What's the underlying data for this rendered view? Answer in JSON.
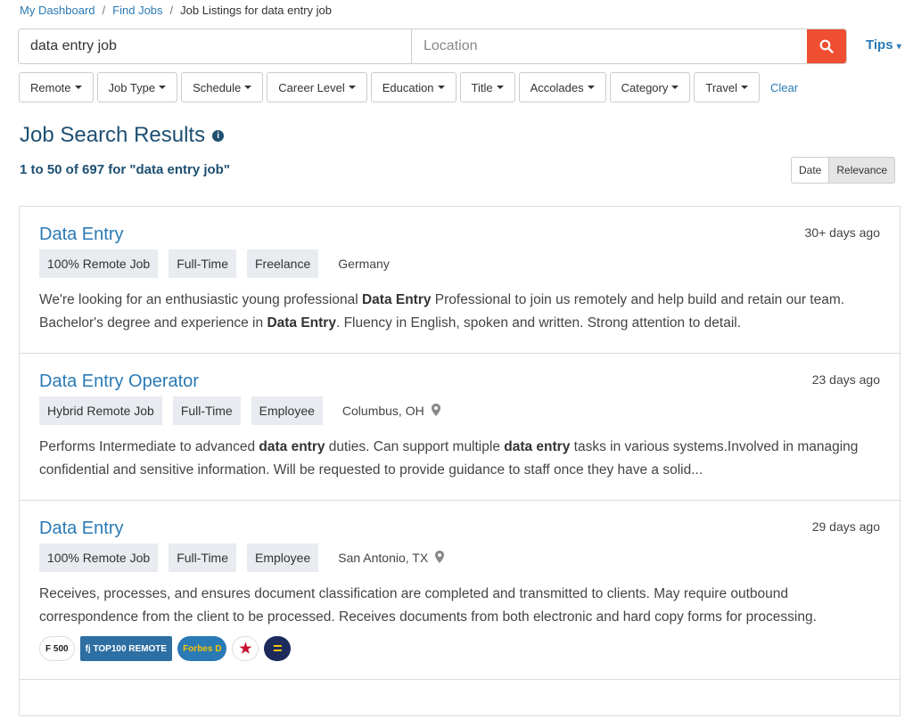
{
  "breadcrumb": {
    "items": [
      "My Dashboard",
      "Find Jobs"
    ],
    "current": "Job Listings for data entry job"
  },
  "search": {
    "query": "data entry job",
    "location_placeholder": "Location",
    "tips": "Tips"
  },
  "filters": [
    "Remote",
    "Job Type",
    "Schedule",
    "Career Level",
    "Education",
    "Title",
    "Accolades",
    "Category",
    "Travel"
  ],
  "clear": "Clear",
  "results": {
    "title": "Job Search Results",
    "count": "1 to 50 of 697 for \"data entry job\"",
    "sort": [
      "Date",
      "Relevance"
    ]
  },
  "jobs": [
    {
      "title": "Data Entry",
      "age": "30+ days ago",
      "tags": [
        "100% Remote Job",
        "Full-Time",
        "Freelance"
      ],
      "location": "Germany",
      "desc": [
        [
          "We're looking for an enthusiastic young professional ",
          false
        ],
        [
          "Data Entry",
          true
        ],
        [
          " Professional to join us remotely and help build and retain our team. Bachelor's degree and experience in ",
          false
        ],
        [
          "Data Entry",
          true
        ],
        [
          ". Fluency in English, spoken and written. Strong attention to detail.",
          false
        ]
      ]
    },
    {
      "title": "Data Entry Operator",
      "age": "23 days ago",
      "tags": [
        "Hybrid Remote Job",
        "Full-Time",
        "Employee"
      ],
      "location": "Columbus, OH",
      "desc": [
        [
          "Performs Intermediate to advanced ",
          false
        ],
        [
          "data entry",
          true
        ],
        [
          " duties. Can support multiple ",
          false
        ],
        [
          "data entry",
          true
        ],
        [
          " tasks in various systems.Involved in managing confidential and sensitive information. Will be requested to provide guidance to staff once they have a solid...",
          false
        ]
      ]
    },
    {
      "title": "Data Entry",
      "age": "29 days ago",
      "tags": [
        "100% Remote Job",
        "Full-Time",
        "Employee"
      ],
      "location": "San Antonio, TX",
      "desc": [
        [
          "Receives, processes, and ensures document classification are completed and transmitted to clients. May require outbound correspondence from the client to be processed. Receives documents from both electronic and hard copy forms for processing.",
          false
        ]
      ],
      "accolades": [
        "F 500",
        "fj TOP100 REMOTE",
        "Forbes D",
        "star-award",
        "equality"
      ]
    }
  ],
  "colors": {
    "accent": "#2a7ab5",
    "heading": "#1d4f72",
    "search_button": "#f04e30"
  }
}
